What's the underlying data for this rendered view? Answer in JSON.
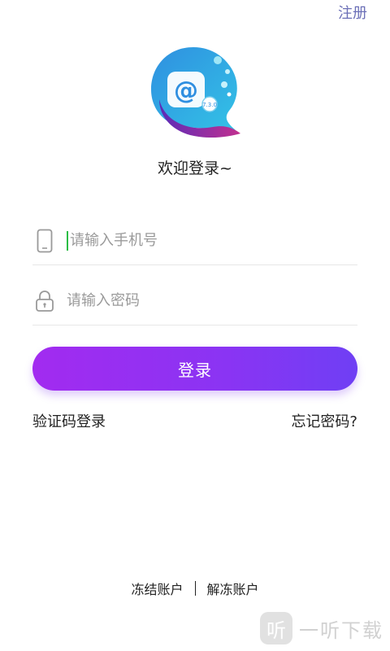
{
  "header": {
    "register_label": "注册"
  },
  "logo": {
    "badge_text": "7.3.0"
  },
  "welcome": {
    "title": "欢迎登录~"
  },
  "form": {
    "phone": {
      "placeholder": "请输入手机号",
      "value": ""
    },
    "password": {
      "placeholder": "请输入密码",
      "value": ""
    },
    "login_label": "登录"
  },
  "links": {
    "sms_login": "验证码登录",
    "forgot_password": "忘记密码?"
  },
  "footer": {
    "freeze": "冻结账户",
    "unfreeze": "解冻账户"
  },
  "watermark": {
    "glyph": "听",
    "text": "一听下载"
  },
  "colors": {
    "accent": "#8a34f3",
    "accent_start": "#a22bf0",
    "register": "#6b6fb7",
    "cursor": "#2bbd45"
  }
}
